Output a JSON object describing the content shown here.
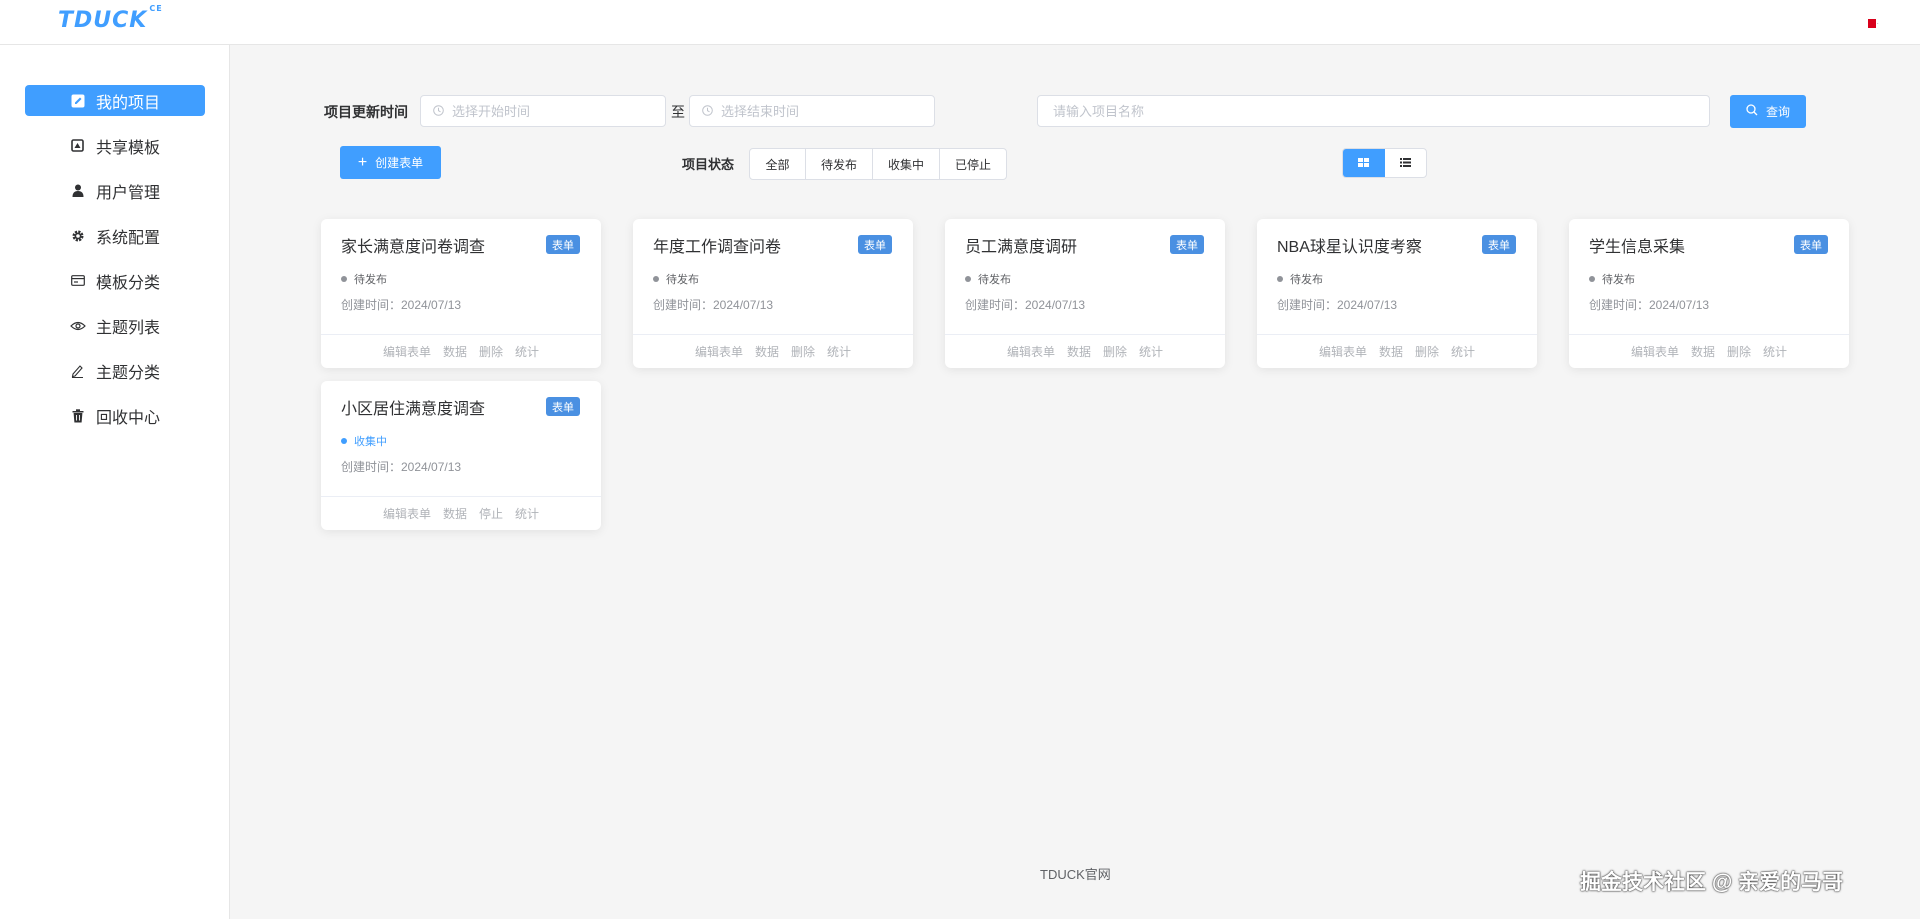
{
  "header": {
    "logo": "TDUCK",
    "logo_sup": "CE"
  },
  "sidebar": {
    "items": [
      {
        "label": "我的项目",
        "icon": "edit-icon"
      },
      {
        "label": "共享模板",
        "icon": "template-icon"
      },
      {
        "label": "用户管理",
        "icon": "user-icon"
      },
      {
        "label": "系统配置",
        "icon": "gear-icon"
      },
      {
        "label": "模板分类",
        "icon": "card-icon"
      },
      {
        "label": "主题列表",
        "icon": "eye-icon"
      },
      {
        "label": "主题分类",
        "icon": "pen-icon"
      },
      {
        "label": "回收中心",
        "icon": "trash-icon"
      }
    ]
  },
  "filters": {
    "date_label": "项目更新时间",
    "start_placeholder": "选择开始时间",
    "to": "至",
    "end_placeholder": "选择结束时间",
    "name_placeholder": "请输入项目名称",
    "search_label": "查询",
    "create_label": "创建表单",
    "status_label": "项目状态",
    "status_options": [
      "全部",
      "待发布",
      "收集中",
      "已停止"
    ]
  },
  "cards": [
    {
      "title": "家长满意度问卷调查",
      "tag": "表单",
      "status": "待发布",
      "created": "创建时间：2024/07/13",
      "actions": [
        "编辑表单",
        "数据",
        "删除",
        "统计"
      ]
    },
    {
      "title": "年度工作调查问卷",
      "tag": "表单",
      "status": "待发布",
      "created": "创建时间：2024/07/13",
      "actions": [
        "编辑表单",
        "数据",
        "删除",
        "统计"
      ]
    },
    {
      "title": "员工满意度调研",
      "tag": "表单",
      "status": "待发布",
      "created": "创建时间：2024/07/13",
      "actions": [
        "编辑表单",
        "数据",
        "删除",
        "统计"
      ]
    },
    {
      "title": "NBA球星认识度考察",
      "tag": "表单",
      "status": "待发布",
      "created": "创建时间：2024/07/13",
      "actions": [
        "编辑表单",
        "数据",
        "删除",
        "统计"
      ]
    },
    {
      "title": "学生信息采集",
      "tag": "表单",
      "status": "待发布",
      "created": "创建时间：2024/07/13",
      "actions": [
        "编辑表单",
        "数据",
        "删除",
        "统计"
      ]
    },
    {
      "title": "小区居住满意度调查",
      "tag": "表单",
      "status": "收集中",
      "created": "创建时间：2024/07/13",
      "actions": [
        "编辑表单",
        "数据",
        "停止",
        "统计"
      ]
    }
  ],
  "footer": {
    "link": "TDUCK官网"
  },
  "watermark": "掘金技术社区 @ 亲爱的马哥",
  "colors": {
    "primary": "#409eff",
    "tag": "#4a90e2"
  }
}
